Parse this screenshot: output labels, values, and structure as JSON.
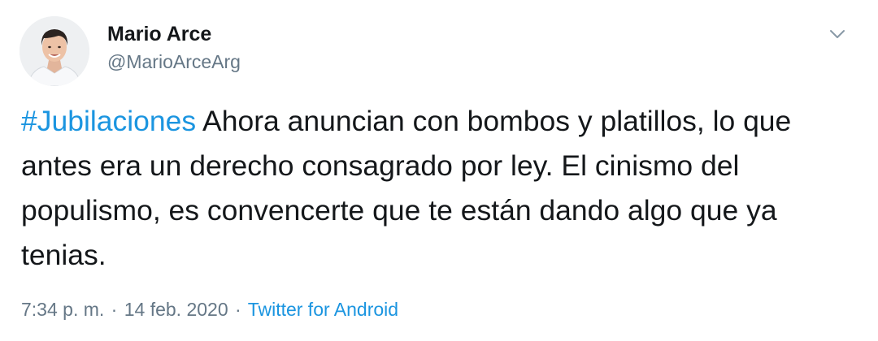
{
  "author": {
    "display_name": "Mario Arce",
    "handle": "@MarioArceArg",
    "avatar_icon": "profile-photo"
  },
  "menu": {
    "icon": "chevron-down-icon"
  },
  "tweet": {
    "hashtag": "#Jubilaciones",
    "text": " Ahora anuncian con bombos y platillos, lo que antes era un derecho consagrado por ley. El cinismo del populismo, es convencerte que te están dando algo que ya tenias."
  },
  "meta": {
    "time": "7:34 p. m.",
    "date": "14 feb. 2020",
    "separator": "·",
    "source": "Twitter for Android"
  },
  "colors": {
    "link": "#1b95e0",
    "secondary_text": "#657786",
    "primary_text": "#14171a"
  }
}
